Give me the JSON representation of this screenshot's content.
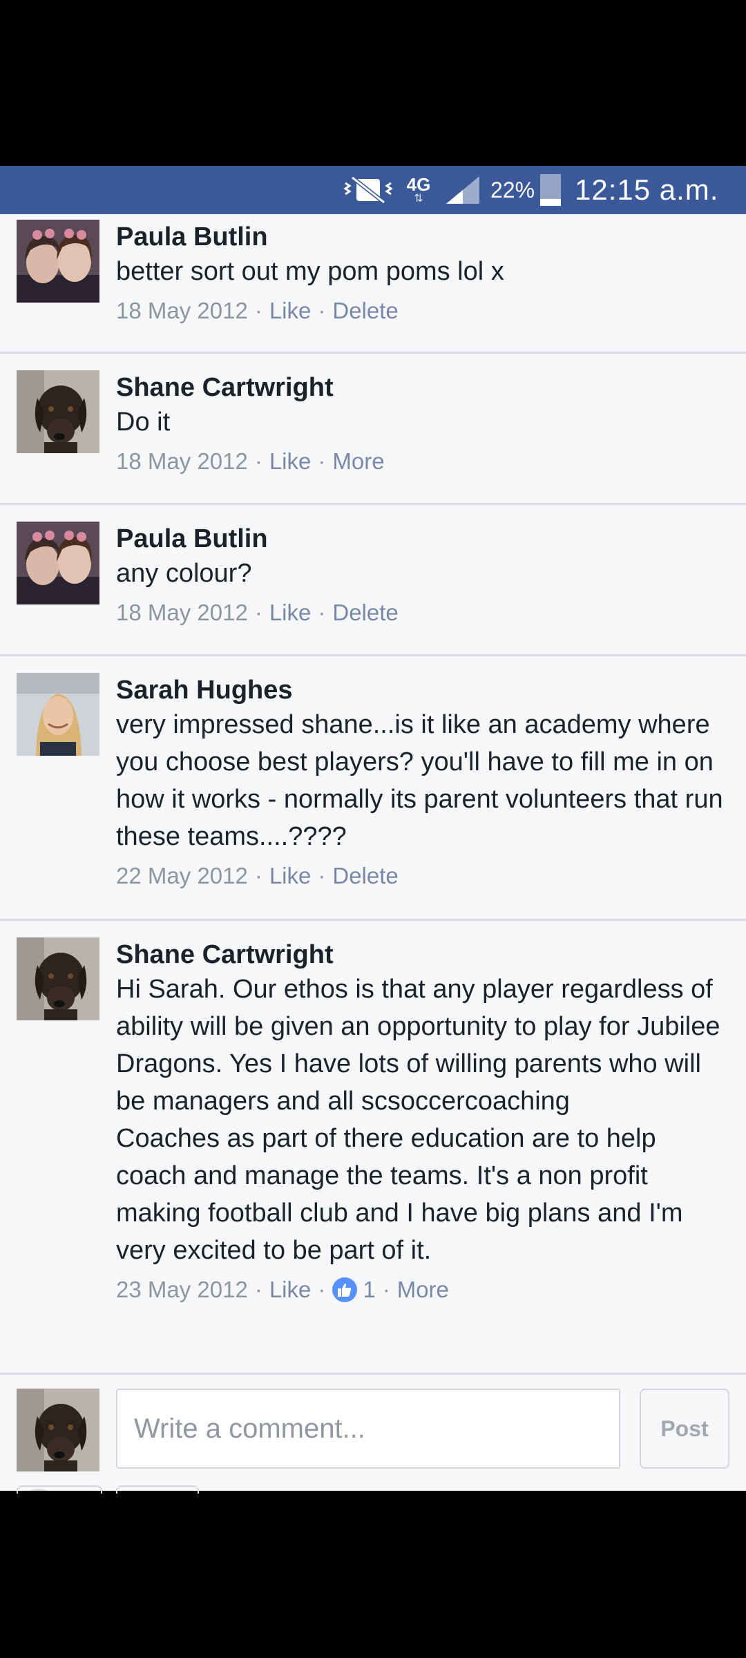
{
  "status_bar": {
    "network_type": "4G",
    "battery_percent": "22%",
    "battery_level": 0.22,
    "time": "12:15 a.m.",
    "icons": [
      "vibrate-mute-icon",
      "signal-icon",
      "battery-icon"
    ]
  },
  "comments": [
    {
      "author": "Paula Butlin",
      "text": "better sort out my pom poms lol x",
      "date": "18 May 2012",
      "like_label": "Like",
      "action_label": "Delete",
      "avatar": "two-women-selfie"
    },
    {
      "author": "Shane Cartwright",
      "text": "Do it",
      "date": "18 May 2012",
      "like_label": "Like",
      "action_label": "More",
      "avatar": "chocolate-labrador"
    },
    {
      "author": "Paula Butlin",
      "text": "any colour?",
      "date": "18 May 2012",
      "like_label": "Like",
      "action_label": "Delete",
      "avatar": "two-women-selfie"
    },
    {
      "author": "Sarah Hughes",
      "text": "very impressed shane...is it like an academy where you choose best players? you'll have to fill me in on how it works - normally its parent volunteers that run these teams....????",
      "date": "22 May 2012",
      "like_label": "Like",
      "action_label": "Delete",
      "avatar": "blonde-woman"
    },
    {
      "author": "Shane Cartwright",
      "text": "Hi Sarah. Our ethos is that any player regardless of ability will be given an opportunity to play for Jubilee Dragons. Yes I have lots of willing parents who will be managers and all scsoccercoaching\nCoaches as part of there education are to help coach and manage the teams. It's a non profit making football club and I have big plans and I'm very excited to be part of it.",
      "date": "23 May 2012",
      "like_label": "Like",
      "like_count": "1",
      "action_label": "More",
      "avatar": "chocolate-labrador"
    }
  ],
  "composer": {
    "placeholder": "Write a comment...",
    "post_label": "Post",
    "avatar": "chocolate-labrador"
  },
  "colors": {
    "header": "#3b5998",
    "link": "#7a88a8",
    "like_badge": "#5890ff"
  }
}
